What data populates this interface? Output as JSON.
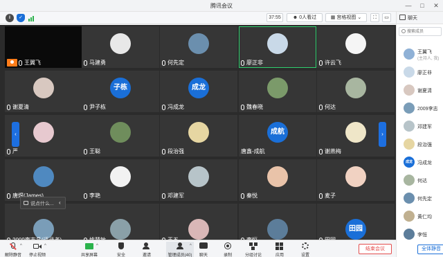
{
  "window": {
    "title": "腾讯会议"
  },
  "topbar": {
    "timer": "37:55",
    "viewers": "0人看过",
    "grid_view": "宫格视图"
  },
  "sidebar": {
    "title": "聊天",
    "search_placeholder": "搜索成员",
    "members": [
      {
        "name": "王翼飞",
        "sub": "(主持人, 我)",
        "avatar_text": "",
        "color": "#8fb1d6"
      },
      {
        "name": "廖正非",
        "sub": "",
        "avatar_text": "",
        "color": "#c9d9e8"
      },
      {
        "name": "谢夏清",
        "sub": "",
        "avatar_text": "",
        "color": "#d8c8c0"
      },
      {
        "name": "2009李志",
        "sub": "",
        "avatar_text": "",
        "color": "#7a9db8"
      },
      {
        "name": "邓建军",
        "sub": "",
        "avatar_text": "",
        "color": "#b7c4c9"
      },
      {
        "name": "段治强",
        "sub": "",
        "avatar_text": "",
        "color": "#e6d6a2"
      },
      {
        "name": "冯成龙",
        "sub": "",
        "avatar_text": "成龙",
        "color": "#1a6fd8"
      },
      {
        "name": "何达",
        "sub": "",
        "avatar_text": "",
        "color": "#a8b6a0"
      },
      {
        "name": "何先定",
        "sub": "",
        "avatar_text": "",
        "color": "#6b8fae"
      },
      {
        "name": "黄仁均",
        "sub": "",
        "avatar_text": "",
        "color": "#c0b090"
      },
      {
        "name": "李恒",
        "sub": "",
        "avatar_text": "",
        "color": "#5c7d9a"
      }
    ],
    "mute_all": "全体静音"
  },
  "grid": {
    "tiles": [
      {
        "name": "王翼飞",
        "host": true,
        "black": true,
        "avatar": "",
        "color": "#000000",
        "mic": "on"
      },
      {
        "name": "马建勇",
        "avatar": "",
        "color": "#e8e8e8",
        "mic": "on"
      },
      {
        "name": "何先定",
        "avatar": "",
        "color": "#6b8fae",
        "mic": "on"
      },
      {
        "name": "廖正非",
        "active": true,
        "avatar": "",
        "color": "#c9d9e8",
        "mic": "on"
      },
      {
        "name": "许云飞",
        "avatar": "",
        "color": "#f5f5f5",
        "mic": "on"
      },
      {
        "name": "谢夏清",
        "avatar": "",
        "color": "#d8c8c0",
        "mic": "on"
      },
      {
        "name": "尹子栋",
        "avatar": "子栋",
        "color": "#1a6fd8",
        "mic": "on"
      },
      {
        "name": "冯成龙",
        "avatar": "成龙",
        "color": "#1a6fd8",
        "mic": "on"
      },
      {
        "name": "魏春晓",
        "avatar": "",
        "color": "#7b9a6a",
        "mic": "on"
      },
      {
        "name": "何达",
        "avatar": "",
        "color": "#a8b6a0",
        "mic": "on"
      },
      {
        "name": "严",
        "avatar": "",
        "color": "#e7c9cf",
        "mic": "on"
      },
      {
        "name": "王聪",
        "avatar": "",
        "color": "#6f8d5c",
        "mic": "on"
      },
      {
        "name": "段治强",
        "avatar": "",
        "color": "#e6d6a2",
        "mic": "on"
      },
      {
        "name": "唐鑫-成航",
        "avatar": "成航",
        "color": "#1a6fd8",
        "mic": "none"
      },
      {
        "name": "谢燕梅",
        "avatar": "",
        "color": "#efe6c8",
        "mic": "on"
      },
      {
        "name": "唐煜(James)",
        "avatar": "",
        "color": "#4f89c0",
        "mic": "on"
      },
      {
        "name": "李艳",
        "avatar": "",
        "color": "#f2f2f2",
        "mic": "on"
      },
      {
        "name": "邓建军",
        "avatar": "",
        "color": "#b7c4c9",
        "mic": "on"
      },
      {
        "name": "秦悦",
        "avatar": "",
        "color": "#e9c3a9",
        "mic": "on"
      },
      {
        "name": "麦子",
        "avatar": "",
        "color": "#f1d2c2",
        "mic": "on"
      },
      {
        "name": "2009李志昌(语录者)",
        "avatar": "",
        "color": "#7a9db8",
        "mic": "on"
      },
      {
        "name": "姚慧敏",
        "avatar": "",
        "color": "#8aa0a8",
        "mic": "on"
      },
      {
        "name": "王五",
        "avatar": "",
        "color": "#d9b7b7",
        "mic": "on"
      },
      {
        "name": "李恒",
        "avatar": "",
        "color": "#5c7d9a",
        "mic": "on"
      },
      {
        "name": "田园",
        "avatar": "田园",
        "color": "#1a6fd8",
        "mic": "on"
      }
    ]
  },
  "chat_popup": {
    "text": "说点什么..."
  },
  "bottombar": {
    "items": [
      {
        "label": "解除静音",
        "icon": "microphone-icon"
      },
      {
        "label": "停止视频",
        "icon": "video-icon"
      },
      {
        "label": "共享屏幕",
        "icon": "share-screen-icon"
      },
      {
        "label": "安全",
        "icon": "shield-icon"
      },
      {
        "label": "邀请",
        "icon": "invite-icon"
      },
      {
        "label": "管理成员(40)",
        "icon": "members-icon"
      },
      {
        "label": "聊天",
        "icon": "chat-icon"
      },
      {
        "label": "录制",
        "icon": "record-icon"
      },
      {
        "label": "分组讨论",
        "icon": "breakout-icon"
      },
      {
        "label": "应用",
        "icon": "apps-icon"
      },
      {
        "label": "设置",
        "icon": "settings-icon"
      }
    ],
    "end_meeting": "结束会议"
  },
  "colors": {
    "accent": "#1a6fd8",
    "active_border": "#2fd06e",
    "end_red": "#e34d4d",
    "host_orange": "#ff7d1a"
  }
}
